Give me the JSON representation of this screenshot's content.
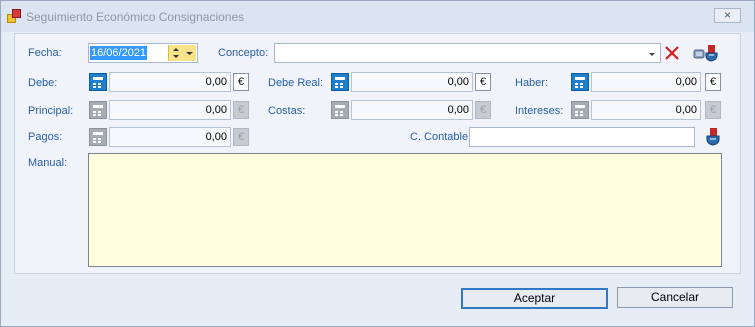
{
  "window": {
    "title": "Seguimiento Económico Consignaciones",
    "close_glyph": "×"
  },
  "labels": {
    "fecha": "Fecha:",
    "concepto": "Concepto:",
    "debe": "Debe:",
    "debe_real": "Debe Real:",
    "haber": "Haber:",
    "principal": "Principal:",
    "costas": "Costas:",
    "intereses": "Intereses:",
    "pagos": "Pagos:",
    "c_contable": "C. Contable:",
    "manual": "Manual:"
  },
  "fields": {
    "fecha": "16/06/2021",
    "concepto": "",
    "debe": "0,00",
    "debe_real": "0,00",
    "haber": "0,00",
    "principal": "0,00",
    "costas": "0,00",
    "intereses": "0,00",
    "pagos": "0,00",
    "c_contable": "",
    "manual": ""
  },
  "currency_symbol": "€",
  "buttons": {
    "accept": "Aceptar",
    "cancel": "Cancelar"
  },
  "icons": {
    "calculator": "calculator-icon",
    "clear": "red-x-icon",
    "concepts": "hand-pointer-icon",
    "account": "hand-pointer-icon"
  },
  "colors": {
    "label": "#2a5ea6",
    "manual_bg": "#ffffe0",
    "calc_active": "#1e7fcc",
    "default_button_border": "#3178c6"
  }
}
